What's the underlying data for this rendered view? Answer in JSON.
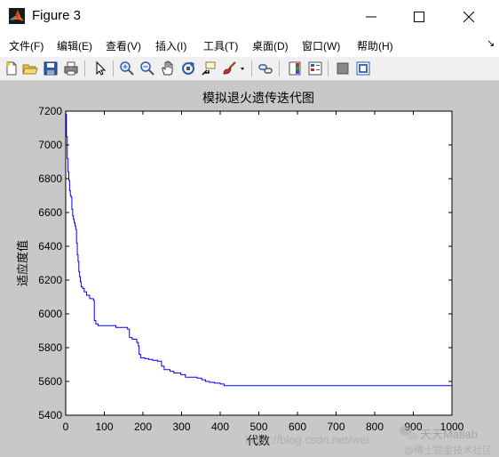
{
  "window": {
    "title": "Figure 3",
    "controls": {
      "minimize": "—",
      "maximize": "☐",
      "close": "✕"
    }
  },
  "menu": {
    "items": [
      "文件(F)",
      "编辑(E)",
      "查看(V)",
      "插入(I)",
      "工具(T)",
      "桌面(D)",
      "窗口(W)",
      "帮助(H)"
    ],
    "overflow": "↘"
  },
  "toolbar": {
    "icons": [
      "new-file-icon",
      "open-folder-icon",
      "save-icon",
      "print-icon",
      "pointer-arrow-icon",
      "zoom-in-icon",
      "zoom-out-icon",
      "pan-hand-icon",
      "rotate-3d-icon",
      "data-cursor-icon",
      "brush-icon",
      "link-plot-icon",
      "colorbar-icon",
      "legend-icon",
      "hide-plot-tools-icon",
      "show-plot-tools-icon"
    ]
  },
  "colors": {
    "figure_background": "#c8c8c8",
    "axes_background": "#ffffff",
    "line": "#0000ff",
    "text": "#000000"
  },
  "chart_data": {
    "type": "line",
    "title": "模拟退火遗传迭代图",
    "xlabel": "代数",
    "ylabel": "适应度值",
    "xlim": [
      0,
      1000
    ],
    "ylim": [
      5400,
      7200
    ],
    "xticks": [
      "0",
      "100",
      "200",
      "300",
      "400",
      "500",
      "600",
      "700",
      "800",
      "900",
      "1000"
    ],
    "yticks": [
      "5400",
      "5600",
      "5800",
      "6000",
      "6200",
      "6400",
      "6600",
      "6800",
      "7000",
      "7200"
    ],
    "grid": false,
    "legend": "none",
    "series": [
      {
        "color": "#0000ff",
        "step": true,
        "points": [
          [
            0,
            7180
          ],
          [
            2,
            7050
          ],
          [
            4,
            6920
          ],
          [
            6,
            6840
          ],
          [
            8,
            6790
          ],
          [
            10,
            6730
          ],
          [
            12,
            6700
          ],
          [
            14,
            6690
          ],
          [
            16,
            6620
          ],
          [
            18,
            6580
          ],
          [
            20,
            6560
          ],
          [
            22,
            6540
          ],
          [
            24,
            6520
          ],
          [
            26,
            6500
          ],
          [
            28,
            6420
          ],
          [
            30,
            6350
          ],
          [
            32,
            6310
          ],
          [
            34,
            6250
          ],
          [
            36,
            6220
          ],
          [
            38,
            6190
          ],
          [
            40,
            6160
          ],
          [
            44,
            6150
          ],
          [
            48,
            6130
          ],
          [
            54,
            6110
          ],
          [
            62,
            6090
          ],
          [
            72,
            6080
          ],
          [
            74,
            5960
          ],
          [
            78,
            5940
          ],
          [
            84,
            5930
          ],
          [
            130,
            5920
          ],
          [
            160,
            5910
          ],
          [
            165,
            5860
          ],
          [
            172,
            5850
          ],
          [
            184,
            5830
          ],
          [
            188,
            5810
          ],
          [
            190,
            5760
          ],
          [
            194,
            5740
          ],
          [
            205,
            5735
          ],
          [
            215,
            5730
          ],
          [
            225,
            5725
          ],
          [
            238,
            5720
          ],
          [
            248,
            5690
          ],
          [
            255,
            5670
          ],
          [
            270,
            5660
          ],
          [
            280,
            5650
          ],
          [
            298,
            5640
          ],
          [
            310,
            5625
          ],
          [
            340,
            5620
          ],
          [
            352,
            5610
          ],
          [
            362,
            5600
          ],
          [
            372,
            5595
          ],
          [
            385,
            5590
          ],
          [
            400,
            5585
          ],
          [
            410,
            5575
          ],
          [
            1000,
            5575
          ]
        ]
      }
    ]
  },
  "watermark": {
    "url": "https://blog.csdn.net/wei",
    "brand": "天天Matlab",
    "sub": "@稀土掘金技术社区"
  }
}
